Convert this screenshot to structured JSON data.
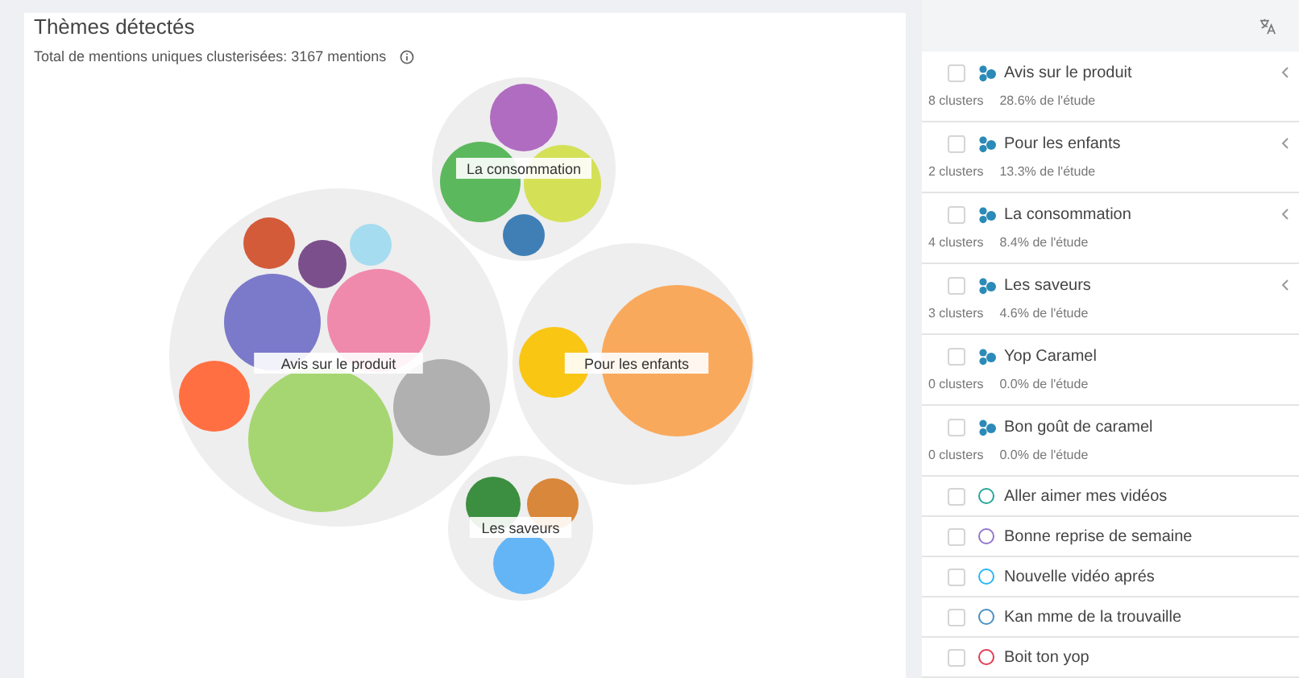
{
  "panel": {
    "title": "Thèmes détectés",
    "subtitle": "Total de mentions uniques clusterisées: 3167 mentions"
  },
  "bubbles": [
    {
      "label": "Avis sur le produit"
    },
    {
      "label": "La consommation"
    },
    {
      "label": "Pour les enfants"
    },
    {
      "label": "Les saveurs"
    }
  ],
  "list": [
    {
      "kind": "theme",
      "label": "Avis sur le produit",
      "clusters": "8 clusters",
      "share": "28.6% de l'étude",
      "checked": false,
      "expandable": true
    },
    {
      "kind": "theme",
      "label": "Pour les enfants",
      "clusters": "2 clusters",
      "share": "13.3% de l'étude",
      "checked": false,
      "expandable": true
    },
    {
      "kind": "theme",
      "label": "La consommation",
      "clusters": "4 clusters",
      "share": "8.4% de l'étude",
      "checked": false,
      "expandable": true
    },
    {
      "kind": "theme",
      "label": "Les saveurs",
      "clusters": "3 clusters",
      "share": "4.6% de l'étude",
      "checked": false,
      "expandable": true
    },
    {
      "kind": "theme",
      "label": "Yop Caramel",
      "clusters": "0 clusters",
      "share": "0.0% de l'étude",
      "checked": false,
      "expandable": false
    },
    {
      "kind": "theme",
      "label": "Bon goût de caramel",
      "clusters": "0 clusters",
      "share": "0.0% de l'étude",
      "checked": false,
      "expandable": false
    },
    {
      "kind": "topic",
      "label": "Aller aimer mes vidéos",
      "color": "#26a69a",
      "checked": false
    },
    {
      "kind": "topic",
      "label": "Bonne reprise de semaine",
      "color": "#9575cd",
      "checked": false
    },
    {
      "kind": "topic",
      "label": "Nouvelle vidéo aprés",
      "color": "#29b6f6",
      "checked": false
    },
    {
      "kind": "topic",
      "label": "Kan mme de la trouvaille",
      "color": "#4a90c2",
      "checked": false
    },
    {
      "kind": "topic",
      "label": "Boit ton yop",
      "color": "#e53950",
      "checked": false
    }
  ]
}
